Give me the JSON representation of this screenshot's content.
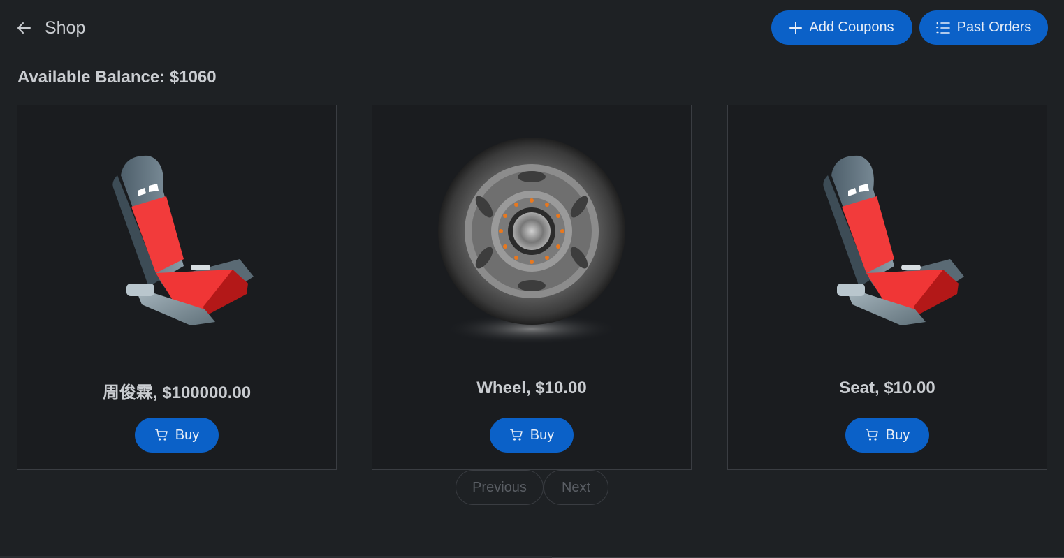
{
  "header": {
    "title": "Shop",
    "back_icon": "arrow-left-icon",
    "add_coupons_label": "Add Coupons",
    "past_orders_label": "Past Orders"
  },
  "balance": {
    "label": "Available Balance: $1060"
  },
  "products": [
    {
      "name": "周俊霖, $100000.00",
      "image": "car-seat",
      "buy_label": "Buy"
    },
    {
      "name": "Wheel, $10.00",
      "image": "wheel",
      "buy_label": "Buy"
    },
    {
      "name": "Seat, $10.00",
      "image": "car-seat",
      "buy_label": "Buy"
    }
  ],
  "pagination": {
    "previous_label": "Previous",
    "next_label": "Next"
  },
  "colors": {
    "background": "#1e2124",
    "card": "#1a1c1f",
    "accent": "#0b61c8"
  }
}
